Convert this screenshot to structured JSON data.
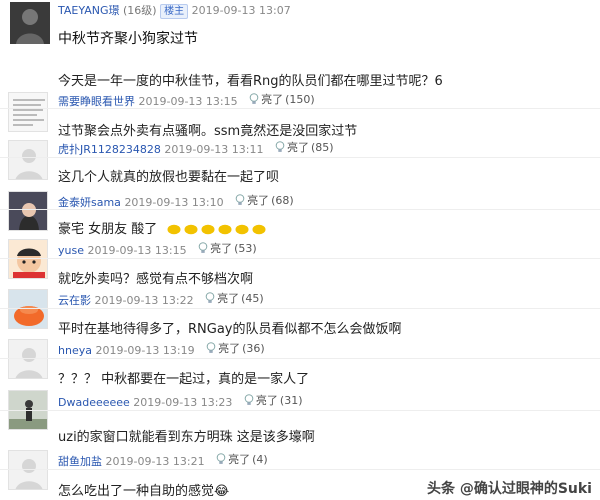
{
  "post": {
    "username": "TAEYANG璟",
    "level": "(16级)",
    "badge": "楼主",
    "timestamp": "2019-09-13 13:07",
    "title": "中秋节齐聚小狗家过节",
    "body": "今天是一年一度的中秋佳节，看看Rng的队员们都在哪里过节呢？6"
  },
  "like_label": "亮了",
  "replies": [
    {
      "username": "需要睁眼看世界",
      "time": "2019-09-13 13:15",
      "likes": "(150)",
      "text": "过节聚会点外卖有点骚啊。ssm竟然还是没回家过节"
    },
    {
      "username": "虎扑JR1128234828",
      "time": "2019-09-13 13:11",
      "likes": "(85)",
      "text": "这几个人就真的放假也要黏在一起了呗"
    },
    {
      "username": "金泰妍sama",
      "time": "2019-09-13 13:10",
      "likes": "(68)",
      "text": "豪宅 女朋友 酸了"
    },
    {
      "username": "yuse",
      "time": "2019-09-13 13:15",
      "likes": "(53)",
      "text": "就吃外卖吗？感觉有点不够档次啊"
    },
    {
      "username": "云在影",
      "time": "2019-09-13 13:22",
      "likes": "(45)",
      "text": "平时在基地待得多了，RNGay的队员看似都不怎么会做饭啊"
    },
    {
      "username": "hneya",
      "time": "2019-09-13 13:19",
      "likes": "(36)",
      "text": "？？？ 中秋都要在一起过，真的是一家人了"
    },
    {
      "username": "Dwadeeeeee",
      "time": "2019-09-13 13:23",
      "likes": "(31)",
      "text": "uzi的家窗口就能看到东方明珠 这是该多壕啊"
    },
    {
      "username": "甜鱼加盐",
      "time": "2019-09-13 13:21",
      "likes": "(4)",
      "text": "怎么吃出了一种自助的感觉😂"
    }
  ],
  "watermark": "头条 @确认过眼神的Suki"
}
